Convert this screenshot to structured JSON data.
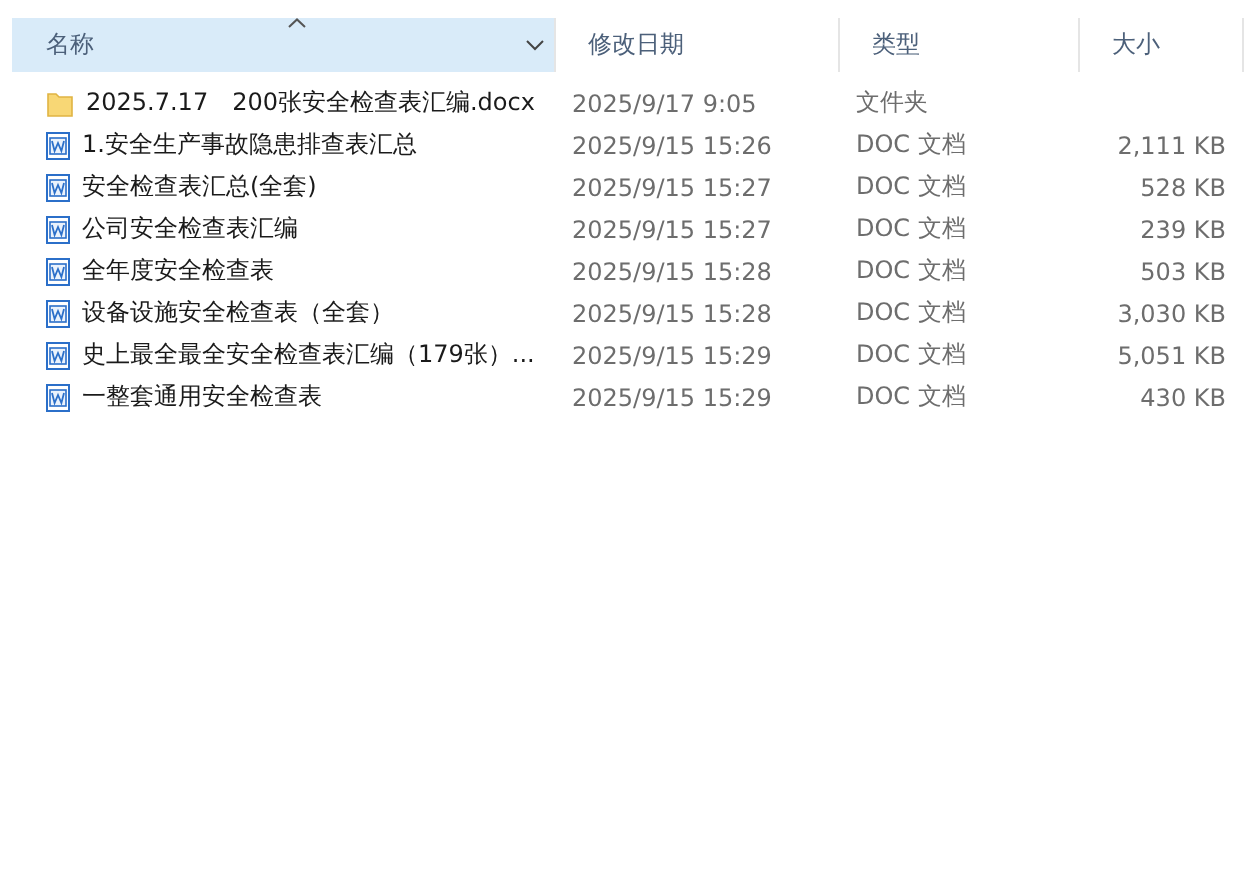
{
  "columns": [
    {
      "label": "名称",
      "sorted": true
    },
    {
      "label": "修改日期",
      "sorted": false
    },
    {
      "label": "类型",
      "sorted": false
    },
    {
      "label": "大小",
      "sorted": false
    }
  ],
  "files": [
    {
      "kind": "folder",
      "name": "2025.7.17　200张安全检查表汇编.docx",
      "date": "2025/9/17 9:05",
      "type": "文件夹"
    },
    {
      "kind": "doc",
      "name": "1.安全生产事故隐患排查表汇总",
      "date": "2025/9/15 15:26",
      "type": "DOC 文档",
      "size": "2,111 KB"
    },
    {
      "kind": "doc",
      "name": "安全检查表汇总(全套)",
      "date": "2025/9/15 15:27",
      "type": "DOC 文档",
      "size": "528 KB"
    },
    {
      "kind": "doc",
      "name": "公司安全检查表汇编",
      "date": "2025/9/15 15:27",
      "type": "DOC 文档",
      "size": "239 KB"
    },
    {
      "kind": "doc",
      "name": "全年度安全检查表",
      "date": "2025/9/15 15:28",
      "type": "DOC 文档",
      "size": "503 KB"
    },
    {
      "kind": "doc",
      "name": "设备设施安全检查表（全套）",
      "date": "2025/9/15 15:28",
      "type": "DOC 文档",
      "size": "3,030 KB"
    },
    {
      "kind": "doc",
      "name": "史上最全最全安全检查表汇编（179张）...",
      "date": "2025/9/15 15:29",
      "type": "DOC 文档",
      "size": "5,051 KB"
    },
    {
      "kind": "doc",
      "name": "一整套通用安全检查表",
      "date": "2025/9/15 15:29",
      "type": "DOC 文档",
      "size": "430 KB"
    }
  ]
}
